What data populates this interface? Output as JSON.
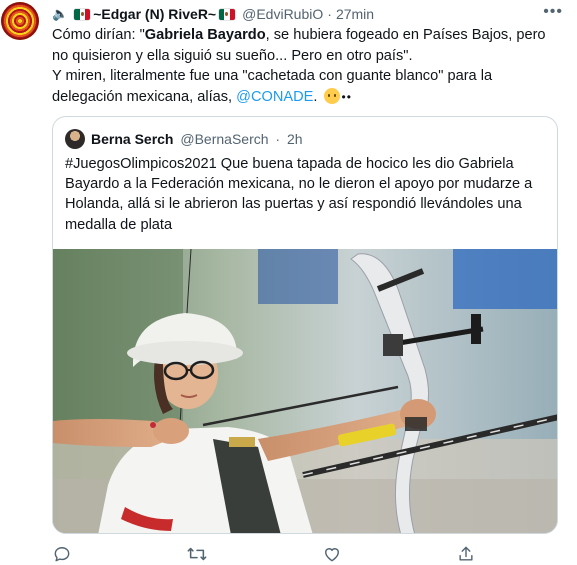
{
  "tweet": {
    "display_name": "~Edgar (N) RiveR~",
    "handle": "@EdviRubiO",
    "separator": "·",
    "time": "27min",
    "more": "•••",
    "text_1": "Cómo dirían: \"",
    "text_bold": "Gabriela Bayardo",
    "text_2": ", se hubiera fogeado en Países Bajos, pero no quisieron y ella siguió su sueño... Pero en otro país\".",
    "text_3": "Y miren, literalmente fue una \"cachetada con guante blanco\" para la delegación mexicana, alías, ",
    "mention": "@CONADE",
    "text_4": ".",
    "text_dots": "••"
  },
  "quote": {
    "display_name": "Berna Serch",
    "handle": "@BernaSerch",
    "separator": "·",
    "time": "2h",
    "text": "#JuegosOlimpicos2021 Que buena tapada de hocico les dio Gabriela Bayardo a la Federación mexicana, no le dieron el apoyo por mudarze a Holanda, allá si le abrieron las puertas y así respondió llevándoles una medalla de plata"
  },
  "icons": {
    "reply": "reply-icon",
    "retweet": "retweet-icon",
    "like": "like-icon",
    "share": "share-icon",
    "speaker": "speaker-icon",
    "flag": "mexico-flag-icon"
  },
  "colors": {
    "link": "#1d9bf0",
    "muted": "#536471",
    "border": "#cfd9de"
  }
}
